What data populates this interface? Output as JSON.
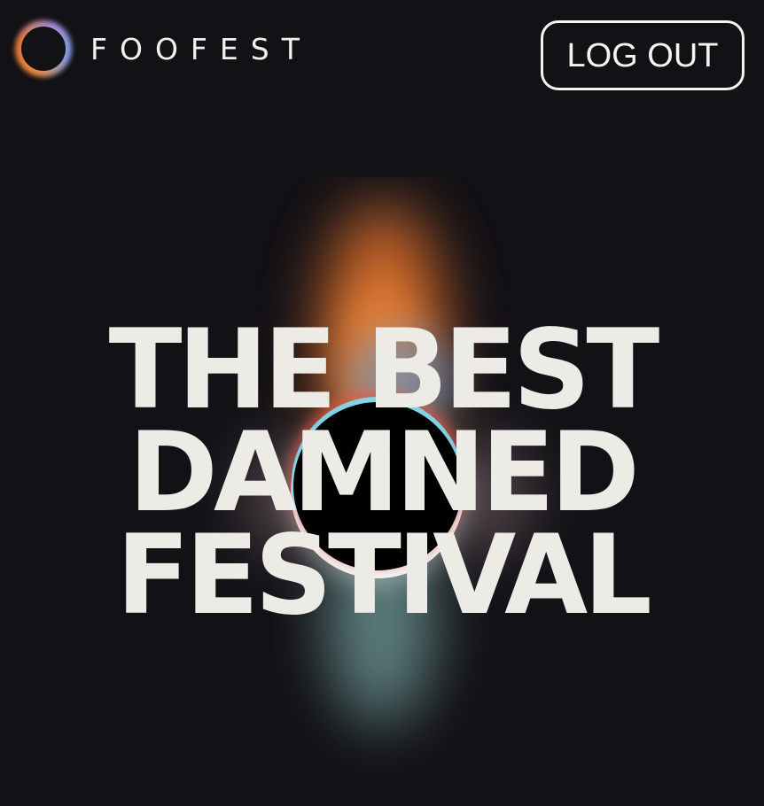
{
  "header": {
    "logo_text": "FOOFEST",
    "logout_label": "LOG OUT"
  },
  "hero": {
    "headline_lines": [
      "THE BEST",
      "DAMNED",
      "FESTIVAL"
    ]
  },
  "colors": {
    "background": "#121116",
    "text": "#ecebe6",
    "accent_orange": "#f08a3c",
    "accent_blue": "#4a9be8",
    "accent_teal": "#8cc3bd",
    "accent_pink": "#c9a6a8"
  },
  "icons": {
    "logo": "eclipse-ring-icon"
  }
}
